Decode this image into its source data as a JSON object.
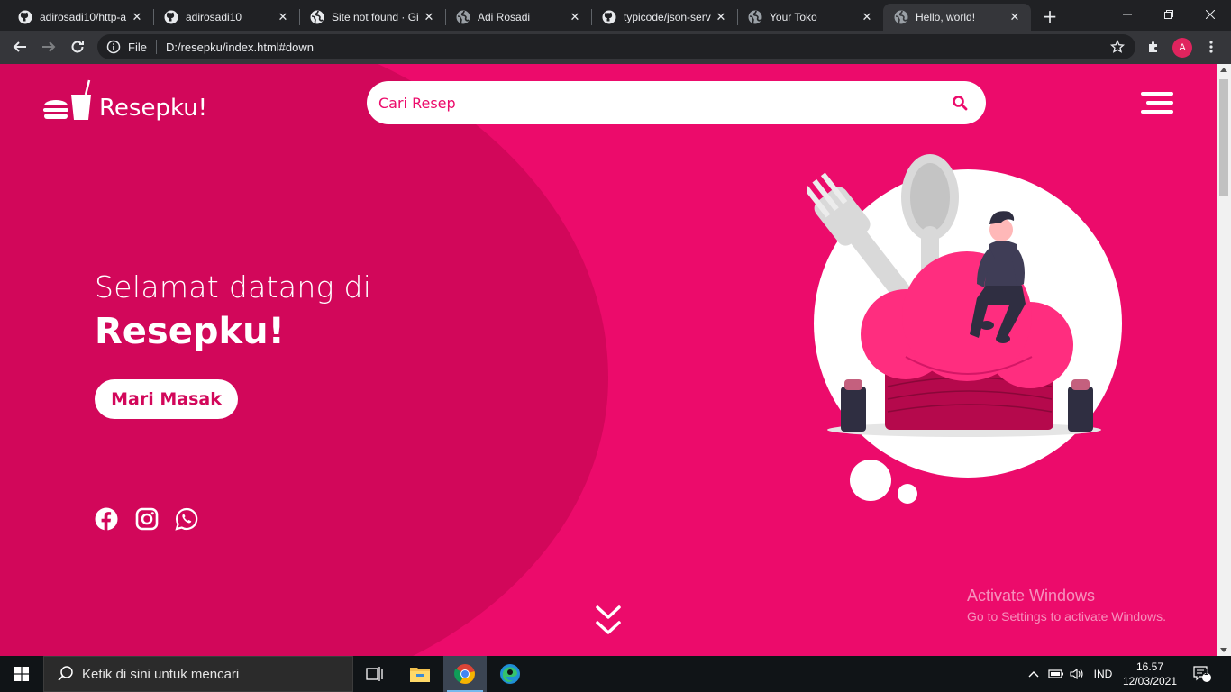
{
  "browser": {
    "tabs": [
      {
        "label": "adirosadi10/http-a",
        "icon": "github-icon"
      },
      {
        "label": "adirosadi10",
        "icon": "github-icon"
      },
      {
        "label": "Site not found · Gi",
        "icon": "globe-icon"
      },
      {
        "label": "Adi Rosadi",
        "icon": "globe-icon"
      },
      {
        "label": "typicode/json-serv",
        "icon": "github-icon"
      },
      {
        "label": "Your Toko",
        "icon": "globe-icon"
      },
      {
        "label": "Hello, world!",
        "icon": "globe-icon",
        "active": true
      }
    ],
    "scheme_label": "File",
    "url": "D:/resepku/index.html#down",
    "profile_initial": "A"
  },
  "page": {
    "brand": "Resepku!",
    "search_placeholder": "Cari Resep",
    "welcome": "Selamat datang di",
    "title": "Resepku!",
    "cta_label": "Mari Masak",
    "social": [
      "facebook-icon",
      "instagram-icon",
      "whatsapp-icon"
    ],
    "colors": {
      "primary": "#ec0b6b",
      "dark": "#d2075a",
      "white": "#ffffff"
    }
  },
  "watermark": {
    "line1": "Activate Windows",
    "line2": "Go to Settings to activate Windows."
  },
  "taskbar": {
    "search_placeholder": "Ketik di sini untuk mencari",
    "language": "IND",
    "time": "16.57",
    "date": "12/03/2021",
    "notifications": "1"
  }
}
